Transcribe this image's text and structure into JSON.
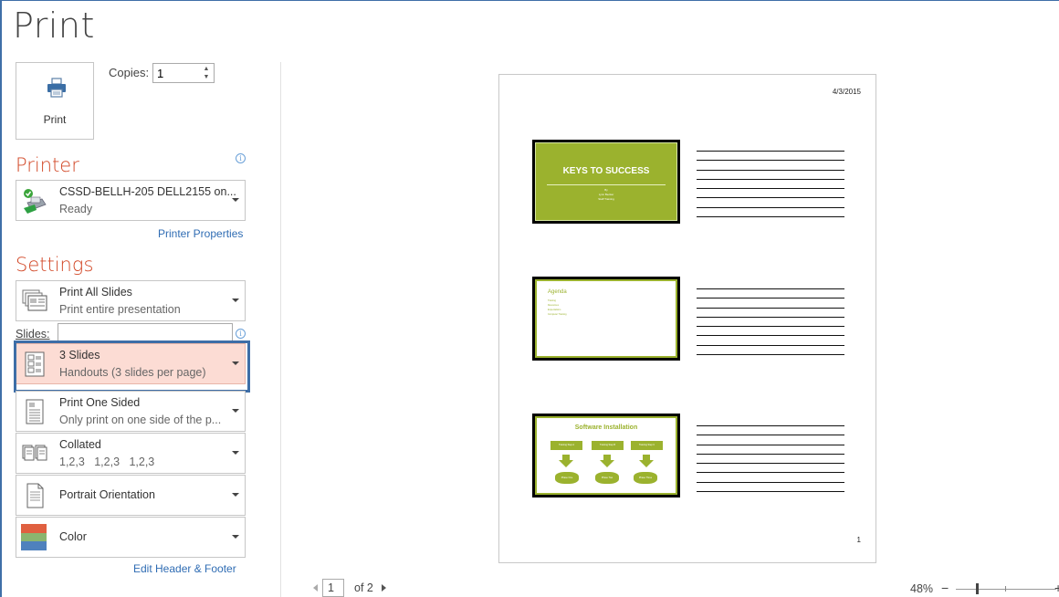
{
  "header": {
    "title": "Print"
  },
  "print_button": {
    "label": "Print",
    "icon": "printer-icon"
  },
  "copies": {
    "label": "Copies:",
    "value": "1"
  },
  "printer": {
    "heading": "Printer",
    "name": "CSSD-BELLH-205 DELL2155 on...",
    "status": "Ready",
    "properties_link": "Printer Properties",
    "info_icon": "info-icon"
  },
  "settings": {
    "heading": "Settings",
    "print_range": {
      "title": "Print All Slides",
      "subtitle": "Print entire presentation"
    },
    "slides_label": "Slides:",
    "slides_value": "",
    "layout": {
      "title": "3 Slides",
      "subtitle": "Handouts (3 slides per page)"
    },
    "sides": {
      "title": "Print One Sided",
      "subtitle": "Only print on one side of the p..."
    },
    "collation": {
      "title": "Collated",
      "subtitle": "1,2,3   1,2,3   1,2,3"
    },
    "orientation": {
      "title": "Portrait Orientation"
    },
    "color": {
      "title": "Color",
      "swatch_colors": [
        "#e06040",
        "#8bb56f",
        "#4f81bd"
      ]
    },
    "header_footer_link": "Edit Header & Footer"
  },
  "preview": {
    "date": "4/3/2015",
    "page_number": "1",
    "accent_color": "#9bb22e",
    "slides": [
      {
        "title": "KEYS TO SUCCESS",
        "subtitle_lines": [
          "By",
          "Lynn Becker",
          "Staff Training"
        ]
      },
      {
        "title": "Agenda",
        "bullets": [
          "Training",
          "Resources",
          "Expectations",
          "Computer Training"
        ]
      },
      {
        "title": "Software Installation",
        "boxes": [
          "Training Step A",
          "Training Step B",
          "Training Step C"
        ],
        "ovals": [
          "Phase One",
          "Phase Two",
          "Phase Three"
        ]
      }
    ]
  },
  "navigation": {
    "current_page": "1",
    "of_label": "of 2"
  },
  "zoom": {
    "level": "48%",
    "minus": "−",
    "plus": "+"
  }
}
